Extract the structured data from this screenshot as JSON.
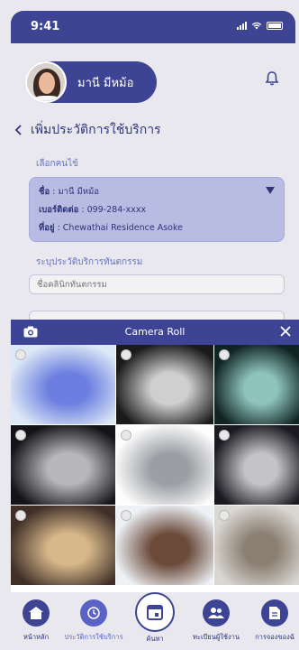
{
  "status_bar": {
    "time": "9:41"
  },
  "profile": {
    "name": "มานี มีหม้อ"
  },
  "page": {
    "title": "เพิ่มประวัติการใช้บริการ"
  },
  "patient_section": {
    "label": "เลือกคนไข้",
    "name_label": "ชื่อ",
    "name_value": "มานี มีหม้อ",
    "phone_label": "เบอร์ติดต่อ",
    "phone_value": "099-284-xxxx",
    "address_label": "ที่อยู่",
    "address_value": "Chewathai Residence Asoke"
  },
  "clinic_section": {
    "label": "ระบุประวัติบริการทันตกรรม",
    "placeholder": "ชื่อคลินิกทันตกรรม"
  },
  "camera_roll": {
    "title": "Camera Roll",
    "photos": [
      {
        "name": "dental-mold-blue",
        "colors": [
          "#dce8f5",
          "#6c7fe0"
        ]
      },
      {
        "name": "panoramic-xray-1",
        "colors": [
          "#1a1a1a",
          "#cfcfcf"
        ]
      },
      {
        "name": "panoramic-xray-2",
        "colors": [
          "#102422",
          "#8fc3bd"
        ]
      },
      {
        "name": "dental-scan-3d-1",
        "colors": [
          "#141418",
          "#b8b8bc"
        ]
      },
      {
        "name": "dental-scan-3d-2",
        "colors": [
          "#fdfdfd",
          "#9b9ea3"
        ]
      },
      {
        "name": "dental-scan-3d-3",
        "colors": [
          "#1a1a20",
          "#c4c4c8"
        ]
      },
      {
        "name": "mall-interior",
        "colors": [
          "#3f2f28",
          "#d8b88a"
        ]
      },
      {
        "name": "friends-hug",
        "colors": [
          "#eef2f7",
          "#6b4a3a"
        ]
      },
      {
        "name": "mirror-selfie",
        "colors": [
          "#d9d7d2",
          "#8b7f72"
        ]
      }
    ]
  },
  "bottom_nav": [
    {
      "label": "หน้าหลัก",
      "icon": "home-icon"
    },
    {
      "label": "ประวัติการใช้บริการ",
      "icon": "history-icon"
    },
    {
      "label": "ค้นหา",
      "icon": "calendar-icon"
    },
    {
      "label": "ทะเบียนผู้ใช้งาน",
      "icon": "users-icon"
    },
    {
      "label": "การจองของฉั",
      "icon": "booking-icon"
    }
  ]
}
